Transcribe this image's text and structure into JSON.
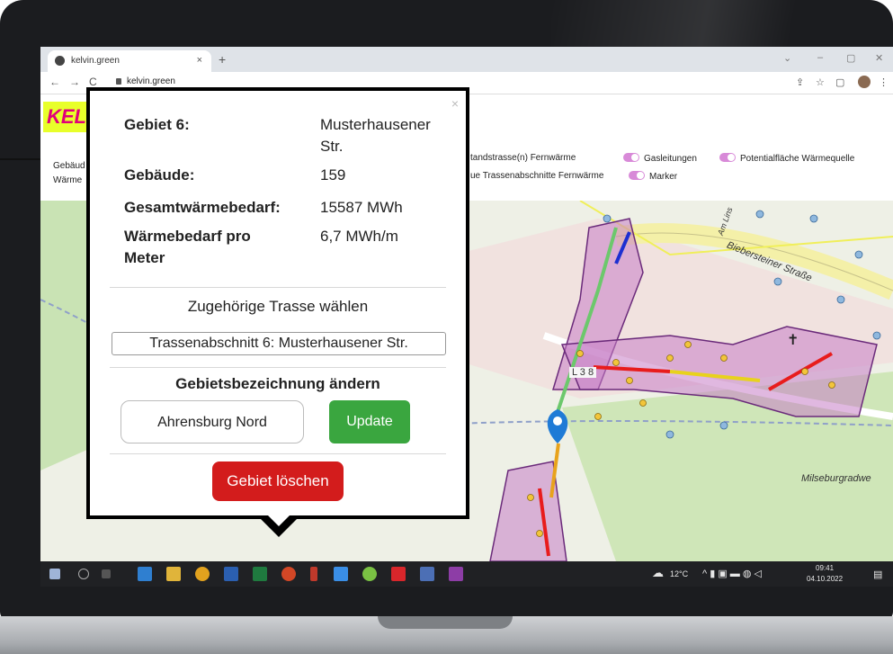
{
  "browser": {
    "tab_title": "kelvin.green",
    "tab_close": "×",
    "new_tab": "+",
    "url": "kelvin.green",
    "controls": {
      "minimize": "–",
      "maximize": "▢",
      "close": "✕",
      "chevron": "⌄"
    }
  },
  "logo_text": "KEL",
  "legend": {
    "row1_left": "Gebäud",
    "row2_left": "Wärme",
    "item_fernwaerme": "tandstrasse(n) Fernwärme",
    "item_gas": "Gasleitungen",
    "item_potential": "Potentialfläche Wärmequelle",
    "item_trassen": "ue Trassenabschnitte Fernwärme",
    "item_marker": "Marker"
  },
  "map": {
    "labels": {
      "street1": "Biebersteiner Straße",
      "street2": "Milseburgradwe",
      "road_sign": "L 3 8",
      "street3": "Am Lins"
    }
  },
  "popup": {
    "close": "×",
    "rows": [
      {
        "key": "Gebiet 6:",
        "value": "Musterhausener Str."
      },
      {
        "key": "Gebäude:",
        "value": "159"
      },
      {
        "key": "Gesamtwärmebedarf:",
        "value": "15587 MWh"
      },
      {
        "key": "Wärmebedarf pro Meter",
        "value": "6,7 MWh/m"
      }
    ],
    "trasse_heading": "Zugehörige Trasse wählen",
    "trasse_selected": "Trassenabschnitt 6: Musterhausener Str.",
    "rename_heading": "Gebietsbezeichnung ändern",
    "name_value": "Ahrensburg Nord",
    "update_label": "Update",
    "delete_label": "Gebiet löschen"
  },
  "taskbar": {
    "temperature": "12°C",
    "time": "09:41",
    "date": "04.10.2022"
  },
  "colors": {
    "update_green": "#3aa63f",
    "delete_red": "#d31c1c",
    "area_purple": "#c77dc7",
    "toggle_pink": "#d88ad8"
  }
}
